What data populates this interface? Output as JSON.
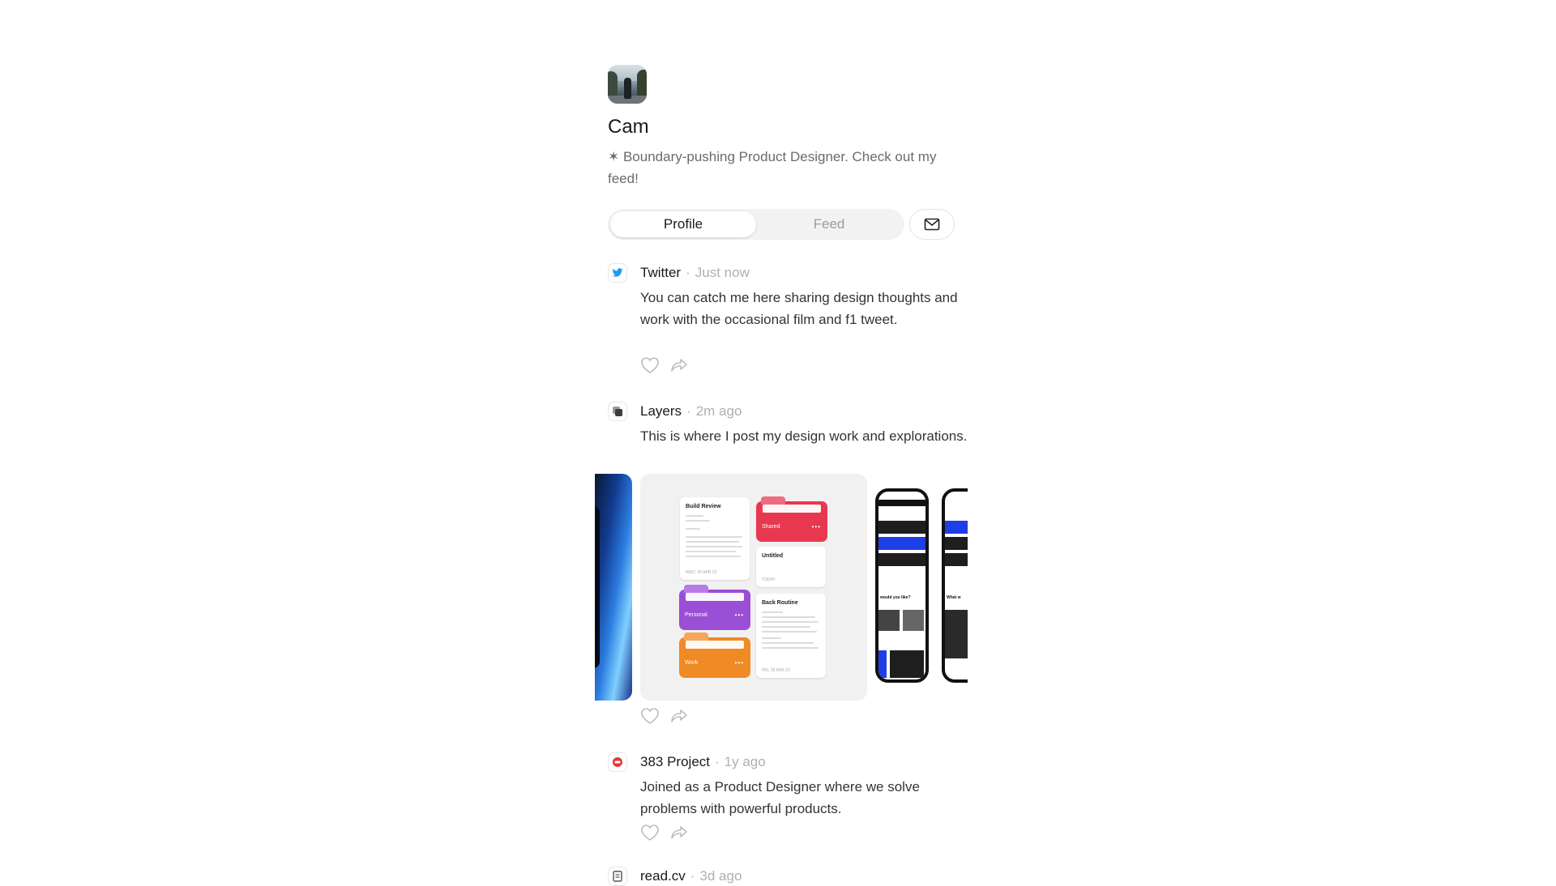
{
  "profile": {
    "name": "Cam",
    "bio": "✶ Boundary-pushing Product Designer. Check out my feed!"
  },
  "tabs": [
    {
      "label": "Profile",
      "active": true
    },
    {
      "label": "Feed",
      "active": false
    }
  ],
  "posts": [
    {
      "source": "Twitter",
      "time": "Just now",
      "icon": "twitter-bird-icon",
      "text": "You can catch me here sharing design thoughts and work with the occasional film and f1 tweet."
    },
    {
      "source": "Layers",
      "time": "2m ago",
      "icon": "layers-icon",
      "text": "This is where I post my design work and explorations.",
      "gallery": {
        "cards": [
          {
            "title": "Build Review",
            "footer": "WED, 26 APR 23"
          },
          {
            "title": "Untitled",
            "footer": "TODAY"
          },
          {
            "title": "Back Routine",
            "footer": "FRI, 28 APR 23"
          }
        ],
        "folders": [
          {
            "label": "Shared",
            "color": "#e8384f"
          },
          {
            "label": "Personal",
            "color": "#9b4fd6"
          },
          {
            "label": "Work",
            "color": "#f08a24"
          }
        ],
        "phone_texts": [
          "would you like?",
          "What w"
        ]
      }
    },
    {
      "source": "383 Project",
      "time": "1y ago",
      "icon": "383-project-icon",
      "text": "Joined as a Product Designer where we solve problems with powerful products."
    },
    {
      "source": "read.cv",
      "time": "3d ago",
      "icon": "readcv-icon",
      "text": ""
    }
  ],
  "colors": {
    "twitter": "#1d9bf0",
    "project383": "#e53935",
    "muted_text": "#b0b0b0"
  },
  "separator": "·"
}
